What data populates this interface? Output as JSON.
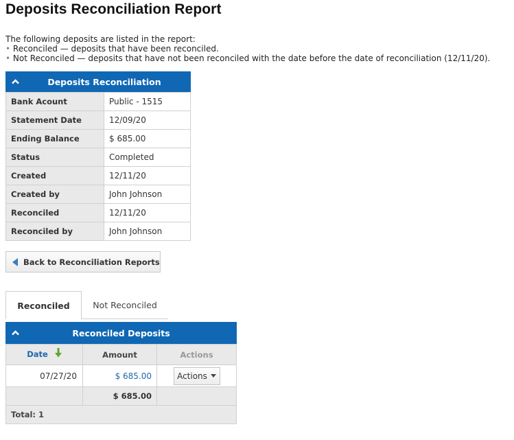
{
  "page": {
    "title": "Deposits Reconciliation Report"
  },
  "intro": {
    "lead": "The following deposits are listed in the report:",
    "bullet_char": "•",
    "items": [
      "Reconciled — deposits that have been reconciled.",
      "Not Reconciled — deposits that have not been reconciled with the date before the date of reconciliation (12/11/20)."
    ]
  },
  "info_panel": {
    "header": "Deposits Reconciliation",
    "collapse_icon": "chevron-up-icon",
    "rows": [
      {
        "label": "Bank Acount",
        "value": "Public - 1515"
      },
      {
        "label": "Statement Date",
        "value": "12/09/20"
      },
      {
        "label": "Ending Balance",
        "value": "$ 685.00"
      },
      {
        "label": "Status",
        "value": "Completed"
      },
      {
        "label": "Created",
        "value": "12/11/20"
      },
      {
        "label": "Created by",
        "value": "John Johnson"
      },
      {
        "label": "Reconciled",
        "value": "12/11/20"
      },
      {
        "label": "Reconciled by",
        "value": "John Johnson"
      }
    ]
  },
  "back_button": {
    "label": "Back to Reconciliation Reports",
    "icon": "triangle-left-icon"
  },
  "tabs": [
    {
      "label": "Reconciled",
      "active": true
    },
    {
      "label": "Not Reconciled",
      "active": false
    }
  ],
  "deposits_panel": {
    "header": "Reconciled Deposits",
    "collapse_icon": "chevron-up-icon",
    "columns": {
      "date": "Date",
      "amount": "Amount",
      "actions": "Actions"
    },
    "sort_icon": "arrow-down-icon",
    "rows": [
      {
        "date": "07/27/20",
        "amount": "$ 685.00",
        "action_label": "Actions"
      }
    ],
    "subtotal": "$ 685.00",
    "total_label": "Total: 1"
  },
  "colors": {
    "header_blue": "#1067b4",
    "link_blue": "#1f66ad",
    "sort_arrow_green": "#5aa832",
    "row_grey": "#e9e9e9"
  }
}
